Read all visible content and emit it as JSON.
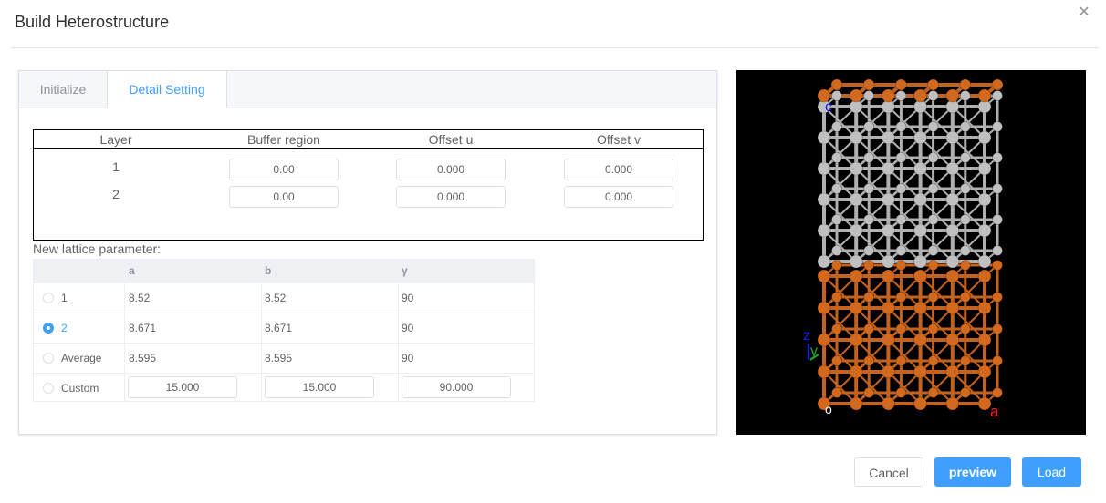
{
  "dialog": {
    "title": "Build Heterostructure"
  },
  "tabs": [
    {
      "label": "Initialize"
    },
    {
      "label": "Detail Setting"
    }
  ],
  "layers_table": {
    "headers": [
      "Layer",
      "Buffer region",
      "Offset u",
      "Offset v"
    ],
    "rows": [
      {
        "layer": "1",
        "buffer": "0.00",
        "offset_u": "0.000",
        "offset_v": "0.000"
      },
      {
        "layer": "2",
        "buffer": "0.00",
        "offset_u": "0.000",
        "offset_v": "0.000"
      }
    ]
  },
  "lattice": {
    "label": "New lattice parameter:",
    "headers": [
      "a",
      "b",
      "γ"
    ],
    "selected": "2",
    "rows": [
      {
        "option": "1",
        "a": "8.52",
        "b": "8.52",
        "gamma": "90"
      },
      {
        "option": "2",
        "a": "8.671",
        "b": "8.671",
        "gamma": "90"
      },
      {
        "option": "Average",
        "a": "8.595",
        "b": "8.595",
        "gamma": "90"
      },
      {
        "option": "Custom",
        "a": "15.000",
        "b": "15.000",
        "gamma": "90.000"
      }
    ]
  },
  "viewer": {
    "axis_labels": {
      "c": "c",
      "z": "z",
      "y": "y",
      "a": "a",
      "o": "o"
    },
    "colors": {
      "top_layer": "#c0c0c0",
      "bottom_layer": "#d2691e",
      "axis_c": "#1a1aff",
      "axis_z": "#1a1aff",
      "axis_y": "#1aa81a",
      "axis_a": "#ff2020"
    }
  },
  "buttons": {
    "cancel": "Cancel",
    "preview": "preview",
    "load": "Load"
  },
  "colors": {
    "accent": "#409eff"
  }
}
